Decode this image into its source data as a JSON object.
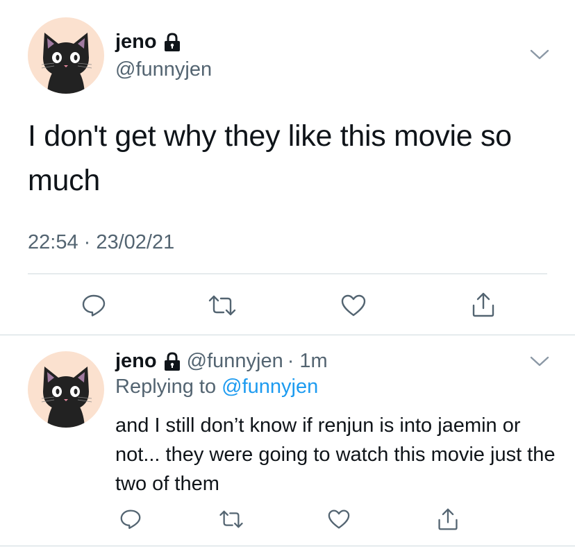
{
  "tweet": {
    "author_name": "jeno",
    "author_handle": "@funnyjen",
    "text": "I don't get why they like this movie so much",
    "timestamp": "22:54 · 23/02/21",
    "avatar_icon": "black-cat-avatar",
    "lock_icon": "lock-icon",
    "menu_icon": "chevron-down-icon",
    "actions": [
      "reply-icon",
      "retweet-icon",
      "like-icon",
      "share-icon"
    ]
  },
  "reply": {
    "author_name": "jeno",
    "author_handle": "@funnyjen",
    "time_ago": "· 1m",
    "replying_prefix": "Replying to",
    "replying_mention": "@funnyjen",
    "text": "and I still don’t know if renjun is into jaemin or not... they were going to watch this movie just the two of them",
    "avatar_icon": "black-cat-avatar",
    "lock_icon": "lock-icon",
    "menu_icon": "chevron-down-icon",
    "actions": [
      "reply-icon",
      "retweet-icon",
      "like-icon",
      "share-icon"
    ]
  },
  "colors": {
    "text": "#0f1419",
    "secondary": "#536471",
    "link": "#1d9bf0",
    "divider": "#cfd9de",
    "avatar_bg": "#fbe1cf"
  }
}
